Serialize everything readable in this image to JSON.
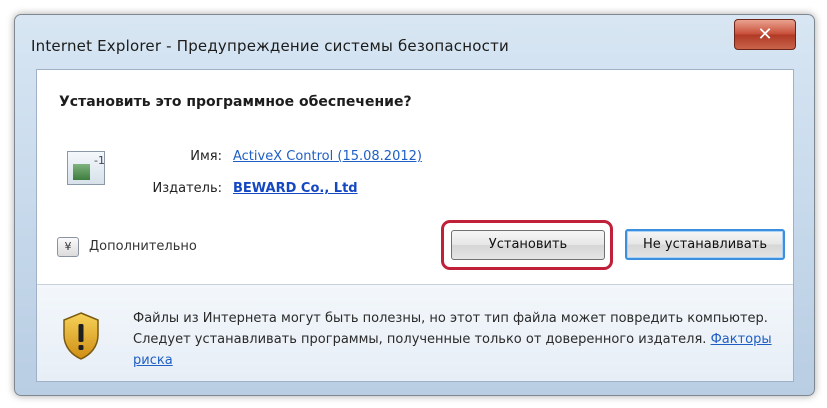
{
  "window": {
    "title": "Internet Explorer - Предупреждение системы безопасности",
    "close_glyph": "✕"
  },
  "dialog": {
    "question": "Установить это программное обеспечение?",
    "name_label": "Имя:",
    "name_value": "ActiveX Control (15.08.2012)",
    "publisher_label": "Издатель:",
    "publisher_value": "BEWARD Co., Ltd",
    "more_toggle_glyph": "¥",
    "more_label": "Дополнительно",
    "install_button": "Установить",
    "dont_install_button": "Не устанавливать",
    "warning_text": "Файлы из Интернета могут быть полезны, но этот тип файла может повредить компьютер. Следует устанавливать программы, полученные только от доверенного издателя.",
    "risk_link": "Факторы риска"
  },
  "colors": {
    "link": "#1f5fc4",
    "highlight": "#c0203a",
    "close_button": "#c8503a",
    "default_button_border": "#3c8fde"
  },
  "icons": {
    "app": "activex-control-icon",
    "warning": "security-shield-icon",
    "close": "close-icon",
    "expand": "chevron-down-icon"
  }
}
